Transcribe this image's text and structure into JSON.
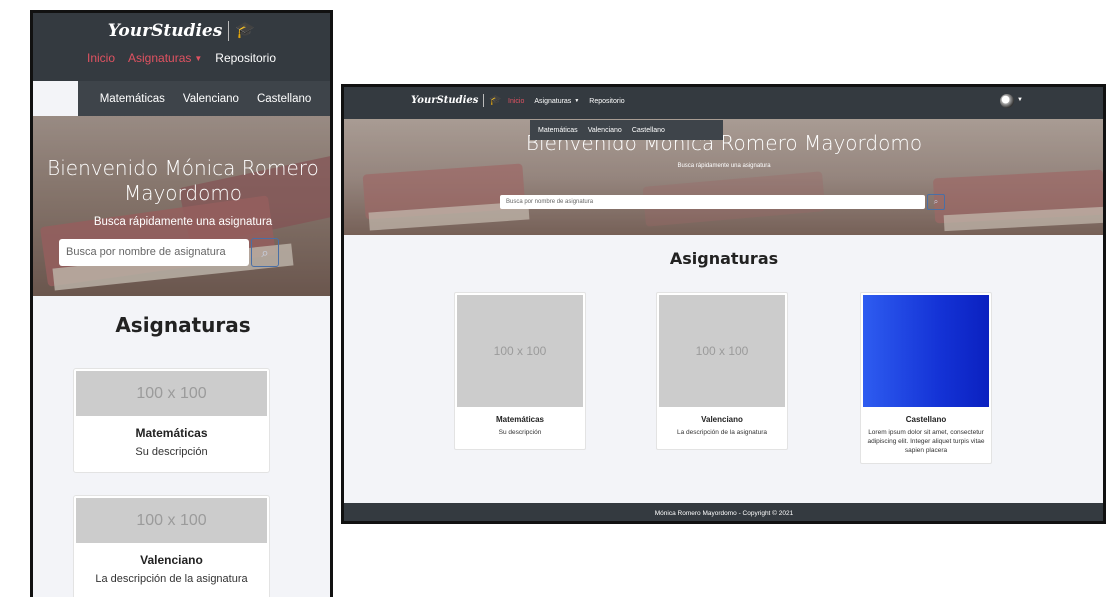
{
  "brand": {
    "name": "YourStudies",
    "icon": "graduation-cap-icon"
  },
  "nav": {
    "inicio": "Inicio",
    "asignaturas": "Asignaturas",
    "repositorio": "Repositorio",
    "caret": "▾"
  },
  "submenu": {
    "item1": "Matemáticas",
    "item2": "Valenciano",
    "item3": "Castellano"
  },
  "hero": {
    "title": "Bienvenido Mónica Romero Mayordomo",
    "subtitle": "Busca rápidamente una asignatura",
    "search_placeholder": "Busca por nombre de asignatura",
    "search_icon": "search-icon"
  },
  "section": {
    "title": "Asignaturas"
  },
  "cards": [
    {
      "thumb": "100 x 100",
      "title": "Matemáticas",
      "description": "Su descripción"
    },
    {
      "thumb": "100 x 100",
      "title": "Valenciano",
      "description": "La descripción de la asignatura"
    },
    {
      "thumb": "",
      "title": "Castellano",
      "description": "Lorem ipsum dolor sit amet, consectetur adipiscing elit. Integer aliquet turpis vitae sapien placera"
    }
  ],
  "footer": {
    "text": "Mónica Romero Mayordomo - Copyright © 2021"
  },
  "colors": {
    "navbar": "#343a40",
    "accent": "#e05261",
    "page_bg": "#f3f4f8",
    "placeholder": "#cccccc",
    "castellano_thumb": "#1433d6"
  }
}
